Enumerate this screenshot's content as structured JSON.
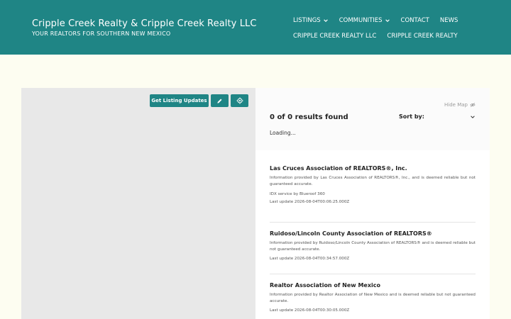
{
  "header": {
    "title": "Cripple Creek Realty & Cripple Creek Realty LLC",
    "tagline": "YOUR REALTORS FOR SOUTHERN NEW MEXICO",
    "background": "#1f8585"
  },
  "nav": {
    "row1": [
      {
        "label": "LISTINGS",
        "dropdown": true
      },
      {
        "label": "COMMUNITIES",
        "dropdown": true
      },
      {
        "label": "CONTACT",
        "dropdown": false
      },
      {
        "label": "NEWS",
        "dropdown": false
      }
    ],
    "row2": [
      {
        "label": "CRIPPLE CREEK REALTY LLC"
      },
      {
        "label": "CRIPPLE CREEK REALTY"
      }
    ]
  },
  "map": {
    "get_updates_label": "Get Listing Updates",
    "edit_icon": "pencil-icon",
    "locate_icon": "crosshair-icon"
  },
  "results": {
    "hide_map_label": "Hide Map",
    "count_text": "0 of 0 results found",
    "sort_label": "Sort by:",
    "loading_text": "Loading..."
  },
  "disclaimers": [
    {
      "title": "Las Cruces Association of REALTORS®, Inc.",
      "text": "Information provided by Las Cruces Association of REALTORS®, Inc., and is deemed reliable but not guaranteed accurate.",
      "idx": "IDX service by Blueroof 360",
      "updated": "Last update 2026-08-04T00:06:25.000Z"
    },
    {
      "title": "Ruidoso/Lincoln County Association of REALTORS®",
      "text": "Information provided by Ruidoso/Lincoln County Association of REALTORS® and is deemed reliable but not guaranteed accurate.",
      "updated": "Last update 2026-08-04T00:34:57.000Z"
    },
    {
      "title": "Realtor Association of New Mexico",
      "text": "Information provided by Realtor Association of New Mexico and is deemed reliable but not guaranteed accurate.",
      "updated": "Last update 2026-08-04T00:30:05.000Z"
    }
  ]
}
